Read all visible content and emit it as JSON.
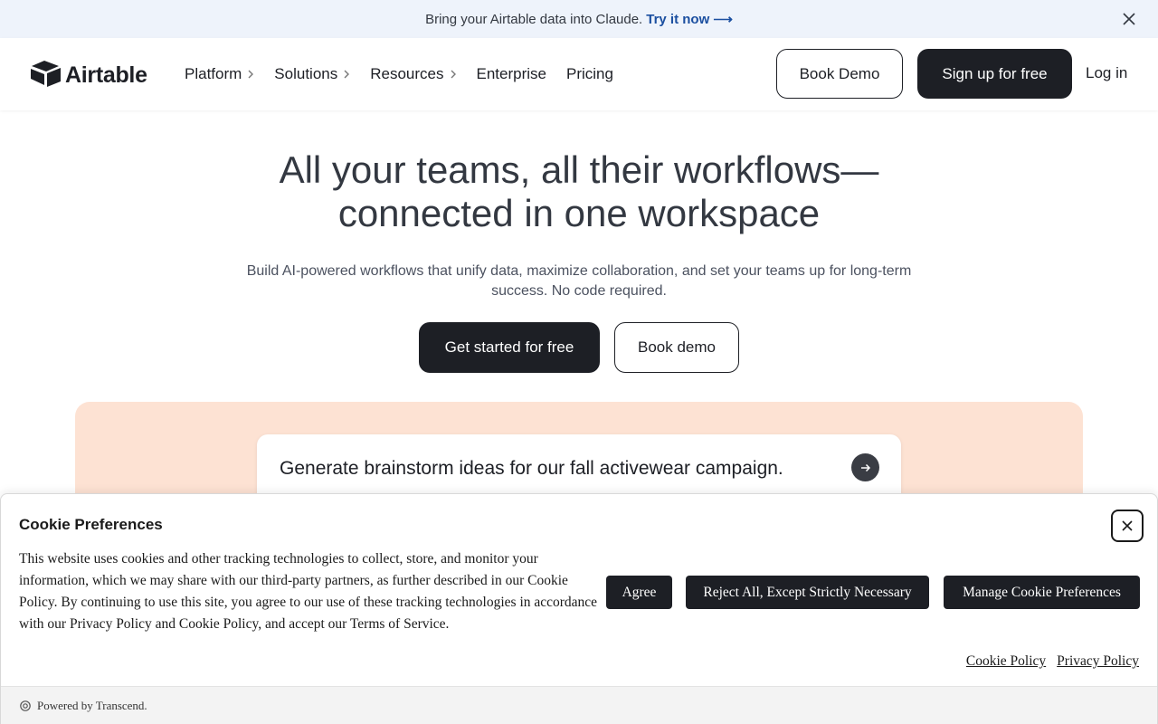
{
  "announcement": {
    "text": "Bring your Airtable data into Claude.",
    "link": "Try it now ⟶"
  },
  "header": {
    "logo_text": "Airtable",
    "nav": [
      {
        "label": "Platform"
      },
      {
        "label": "Solutions"
      },
      {
        "label": "Resources"
      },
      {
        "label": "Enterprise"
      },
      {
        "label": "Pricing"
      }
    ],
    "book_demo": "Book Demo",
    "signup": "Sign up for free",
    "login": "Log in"
  },
  "hero": {
    "title_line1": "All your teams, all their workflows—",
    "title_line2": "connected in one workspace",
    "subtitle": "Build AI-powered workflows that unify data, maximize collaboration, and set your teams up for long-term success. No code required.",
    "cta_primary": "Get started for free",
    "cta_secondary": "Book demo"
  },
  "prompt": {
    "text": "Generate brainstorm ideas for our fall activewear campaign."
  },
  "cookie": {
    "title": "Cookie Preferences",
    "body": "This website uses cookies and other tracking technologies to collect, store, and monitor your information, which we may share with our third-party partners, as further described in our Cookie Policy. By continuing to use this site, you agree to our use of these tracking technologies in accordance with our Privacy Policy and Cookie Policy, and accept our Terms of Service.",
    "agree": "Agree",
    "reject": "Reject All, Except Strictly Necessary",
    "manage": "Manage Cookie Preferences",
    "cookie_policy": "Cookie Policy",
    "privacy_policy": "Privacy Policy",
    "powered_by": "Powered by Transcend."
  },
  "colors": {
    "accent_dark": "#1d1f25",
    "link_blue": "#1b4fa0",
    "panel_peach": "#fde2d3",
    "announce_bg": "#eef3fb"
  }
}
